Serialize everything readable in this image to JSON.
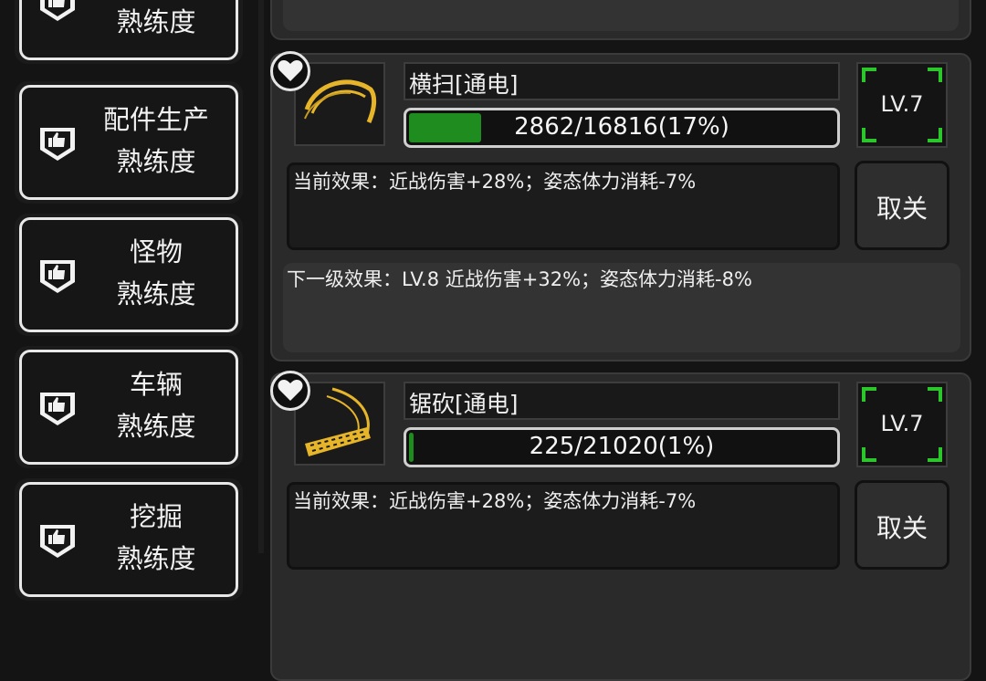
{
  "sidebar": {
    "items": [
      {
        "line1": "",
        "line2": "熟练度"
      },
      {
        "line1": "配件生产",
        "line2": "熟练度"
      },
      {
        "line1": "怪物",
        "line2": "熟练度"
      },
      {
        "line1": "车辆",
        "line2": "熟练度"
      },
      {
        "line1": "挖掘",
        "line2": "熟练度"
      }
    ],
    "icon": "thumbs-up-badge-icon"
  },
  "skills": [
    {
      "name": "横扫[通电]",
      "progress_text": "2862/16816(17%)",
      "progress_fraction": 0.17,
      "level": "LV.7",
      "current_effect": "当前效果：近战伤害+28%；姿态体力消耗-7%",
      "close_label": "取关",
      "next_effect": "下一级效果：LV.8 近战伤害+32%；姿态体力消耗-8%",
      "icon": "sweep-slash-icon"
    },
    {
      "name": "锯砍[通电]",
      "progress_text": "225/21020(1%)",
      "progress_fraction": 0.01,
      "level": "LV.7",
      "current_effect": "当前效果：近战伤害+28%；姿态体力消耗-7%",
      "close_label": "取关",
      "icon": "chainsaw-slash-icon"
    }
  ],
  "colors": {
    "progress_fill": "#1f8c1f",
    "level_corner": "#2cc52c",
    "icon_gold": "#e6b52a"
  }
}
